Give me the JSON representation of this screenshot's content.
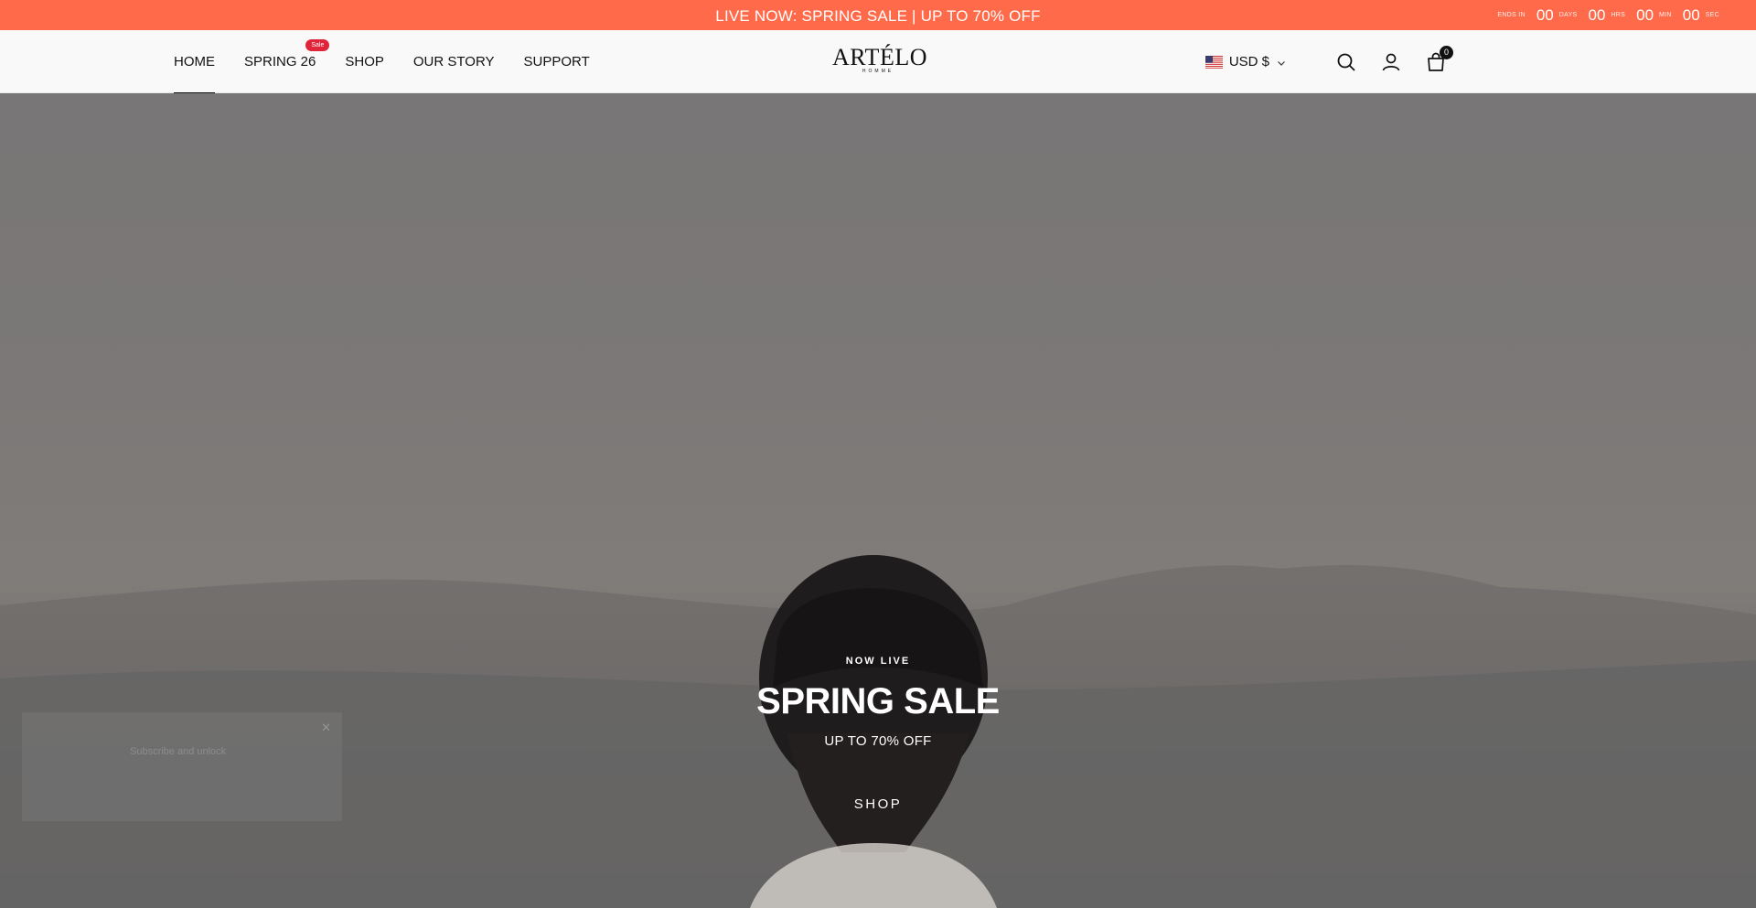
{
  "announcement": {
    "text": "LIVE NOW: SPRING SALE | UP TO 70% OFF",
    "countdown": {
      "ends_in_label": "ENDS IN",
      "days": "00",
      "days_label": "DAYS",
      "hrs": "00",
      "hrs_label": "HRS",
      "min": "00",
      "min_label": "MIN",
      "sec": "00",
      "sec_label": "SEC"
    }
  },
  "nav": {
    "items": [
      {
        "label": "HOME"
      },
      {
        "label": "SPRING 26",
        "badge": "Sale"
      },
      {
        "label": "SHOP"
      },
      {
        "label": "OUR STORY"
      },
      {
        "label": "SUPPORT"
      }
    ]
  },
  "logo": {
    "main": "ARTÉLO",
    "sub": "HOMME"
  },
  "tools": {
    "currency": "USD $",
    "cart_count": "0"
  },
  "hero": {
    "eyebrow": "NOW LIVE",
    "headline": "SPRING SALE",
    "subline": "UP TO 70% OFF",
    "cta": "SHOP"
  },
  "popup": {
    "text": "Subscribe and unlock"
  },
  "colors": {
    "announcement_bg": "#ff6b4a",
    "sale_badge": "#e0243a"
  }
}
